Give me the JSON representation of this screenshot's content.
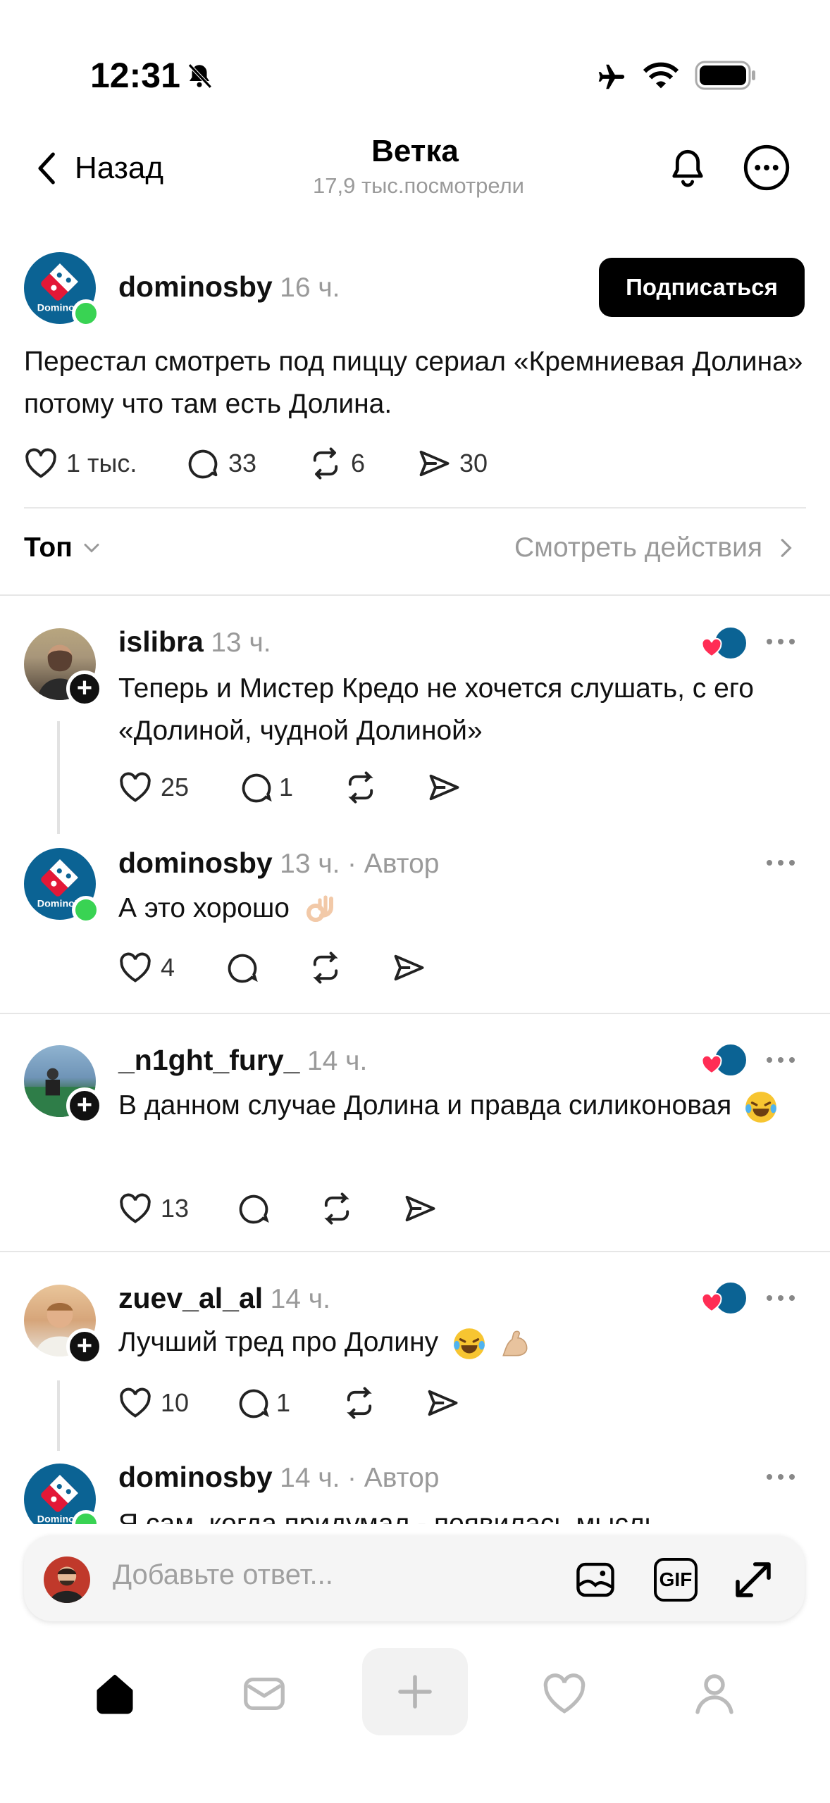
{
  "status_bar": {
    "time": "12:31"
  },
  "header": {
    "back_label": "Назад",
    "title": "Ветка",
    "subtitle": "17,9 тыс.посмотрели"
  },
  "main_post": {
    "username": "dominosby",
    "time": "16 ч.",
    "follow_label": "Подписаться",
    "text": "Перестал смотреть под пиццу сериал «Кремниевая Долина» потому что там есть Долина.",
    "likes": "1 тыс.",
    "comments": "33",
    "reposts": "6",
    "shares": "30"
  },
  "sort_bar": {
    "sort_label": "Топ",
    "activity_label": "Смотреть действия"
  },
  "avatar_text": "Domino's",
  "replies": [
    {
      "username": "islibra",
      "time": "13 ч.",
      "text": "Теперь и Мистер Кредо не хочется слушать, с его «Долиной, чудной Долиной»",
      "likes": "25",
      "comments": "1"
    },
    {
      "username": "dominosby",
      "time": "13 ч.",
      "author_tag": "· Автор",
      "text": "А это хорошо",
      "likes": "4"
    },
    {
      "username": "_n1ght_fury_",
      "time": "14 ч.",
      "text": "В данном случае Долина и правда силиконовая",
      "likes": "13"
    },
    {
      "username": "zuev_al_al",
      "time": "14 ч.",
      "text": "Лучший тред про Долину",
      "likes": "10",
      "comments": "1"
    },
    {
      "username": "dominosby",
      "time": "14 ч.",
      "author_tag": "· Автор",
      "text": "Я сам, когда придумал - появилась мысль"
    }
  ],
  "reply_bar": {
    "placeholder": "Добавьте ответ...",
    "gif_label": "GIF"
  },
  "icons": [
    "chevron-left-icon",
    "bell-icon",
    "more-icon",
    "heart-icon",
    "comment-icon",
    "repost-icon",
    "send-icon",
    "chevron-down-icon",
    "chevron-right-icon",
    "image-icon",
    "expand-icon",
    "home-icon",
    "inbox-icon",
    "plus-icon",
    "profile-icon"
  ],
  "colors": {
    "brand_blue": "#0b6394",
    "online_green": "#39d353",
    "like_red": "#ff2d55"
  }
}
